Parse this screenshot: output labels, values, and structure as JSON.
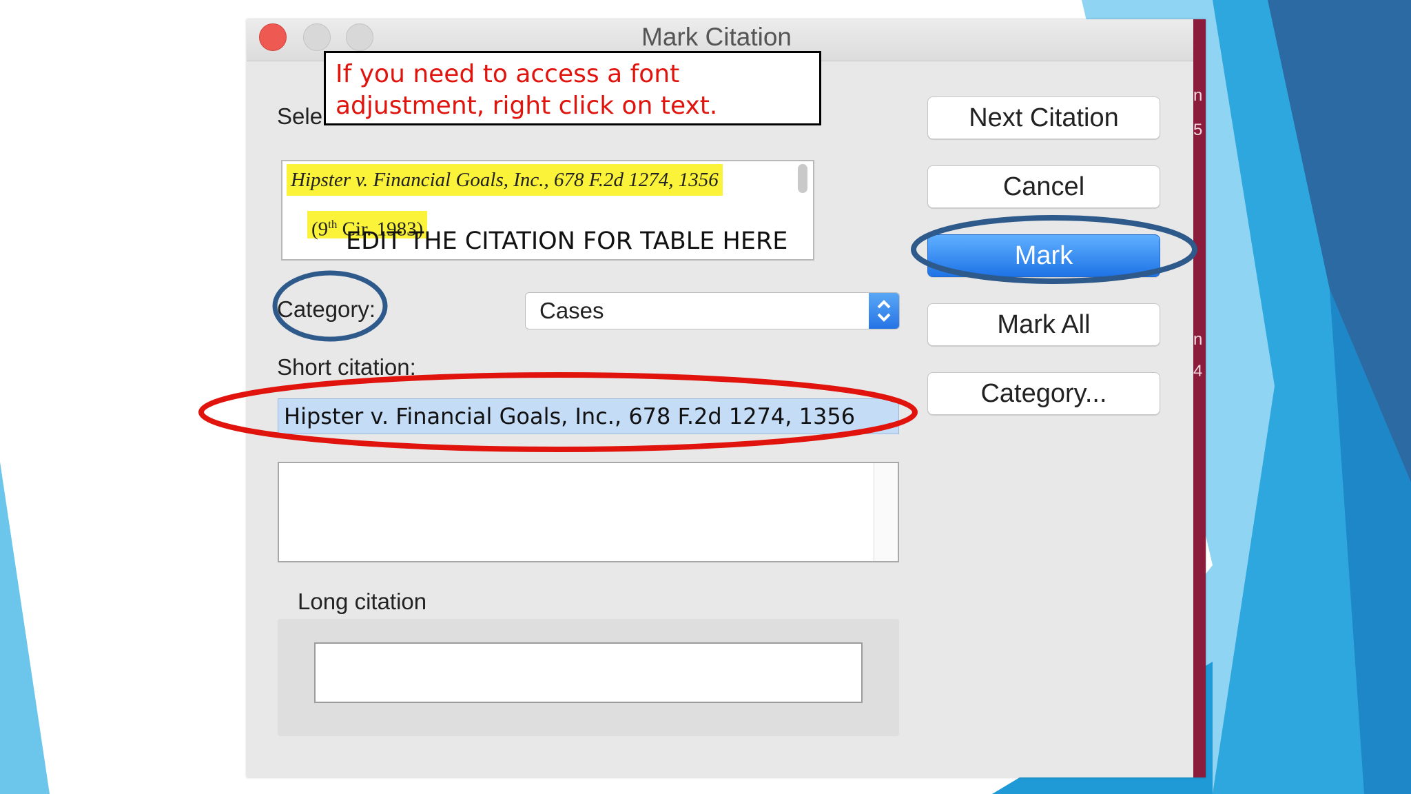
{
  "window": {
    "title": "Mark Citation"
  },
  "note": {
    "line1": "If you need to access a font",
    "line2": "adjustment, right click on text."
  },
  "selected_text": {
    "label": "Sele",
    "line1": "Hipster v. Financial Goals, Inc., 678 F.2d 1274, 1356",
    "line2_prefix": "(9",
    "line2_sup": "th",
    "line2_suffix": " Cir. 1983)"
  },
  "overlay_instruction": "EDIT THE CITATION FOR TABLE HERE",
  "category": {
    "label": "Category:",
    "selected": "Cases"
  },
  "short_citation": {
    "label": "Short citation:",
    "value": "Hipster v. Financial Goals, Inc., 678 F.2d 1274, 1356"
  },
  "long_citation": {
    "label": "Long citation"
  },
  "buttons": {
    "next_citation": "Next Citation",
    "cancel": "Cancel",
    "mark": "Mark",
    "mark_all": "Mark All",
    "category": "Category..."
  },
  "side_glyphs": [
    "n",
    "5",
    "n",
    "4"
  ],
  "colors": {
    "annotation_blue": "#2d5a8a",
    "annotation_red": "#e0140c",
    "note_text": "#e0140c",
    "highlight_yellow": "#fbf33a",
    "primary_button": "#1f74e6",
    "slide_accent": "#29a3de",
    "right_strip": "#8b1c3c"
  }
}
